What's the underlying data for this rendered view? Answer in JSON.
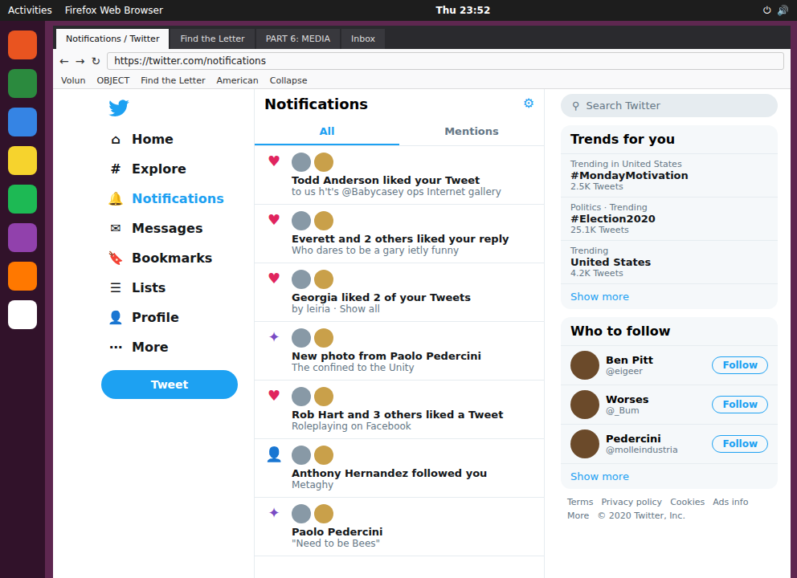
{
  "topbar": {
    "activities": "Activities",
    "app": "Firefox Web Browser",
    "clock": "Thu 23:52",
    "tray": [
      "⏻",
      "🔊"
    ]
  },
  "dock": [
    {
      "color": "#e95420"
    },
    {
      "color": "#2b8a3e"
    },
    {
      "color": "#3584e4"
    },
    {
      "color": "#f6d32d"
    },
    {
      "color": "#1db954"
    },
    {
      "color": "#9141ac"
    },
    {
      "color": "#ff7800"
    },
    {
      "color": "#ffffff"
    }
  ],
  "browser_tabs": [
    {
      "label": "Notifications / Twitter",
      "selected": true
    },
    {
      "label": "Find the Letter",
      "selected": false
    },
    {
      "label": "PART 6: MEDIA",
      "selected": false
    },
    {
      "label": "Inbox",
      "selected": false
    }
  ],
  "url": "https://twitter.com/notifications",
  "bookmarks": [
    "Volun",
    "OBJECT",
    "Find the Letter",
    "American",
    "Collapse"
  ],
  "nav": [
    {
      "icon": "⌂",
      "label": "Home",
      "selected": false
    },
    {
      "icon": "#",
      "label": "Explore",
      "selected": false
    },
    {
      "icon": "🔔",
      "label": "Notifications",
      "selected": true
    },
    {
      "icon": "✉",
      "label": "Messages",
      "selected": false
    },
    {
      "icon": "🔖",
      "label": "Bookmarks",
      "selected": false
    },
    {
      "icon": "☰",
      "label": "Lists",
      "selected": false
    },
    {
      "icon": "👤",
      "label": "Profile",
      "selected": false
    },
    {
      "icon": "⋯",
      "label": "More",
      "selected": false
    }
  ],
  "tweet_button": "Tweet",
  "feed": {
    "title": "Notifications",
    "tabs": [
      {
        "label": "All",
        "selected": true
      },
      {
        "label": "Mentions",
        "selected": false
      }
    ],
    "items": [
      {
        "kind": "like",
        "text": "Todd Anderson liked your Tweet",
        "snippet": "to us h't's @Babycasey ops Internet gallery"
      },
      {
        "kind": "like",
        "text": "Everett and 2 others liked your reply",
        "snippet": "Who dares to be a gary ietly funny"
      },
      {
        "kind": "like",
        "text": "Georgia liked 2 of your Tweets",
        "snippet": "by leiria · Show all"
      },
      {
        "kind": "photo",
        "text": "New photo from Paolo Pedercini",
        "snippet": "The confined to the Unity"
      },
      {
        "kind": "like",
        "text": "Rob Hart and 3 others liked a Tweet",
        "snippet": "Roleplaying on Facebook"
      },
      {
        "kind": "follow",
        "text": "Anthony Hernandez followed you",
        "snippet": "Metaghy"
      },
      {
        "kind": "photo",
        "text": "Paolo Pedercini",
        "snippet": "\"Need to be Bees\""
      }
    ]
  },
  "search": {
    "placeholder": "Search Twitter"
  },
  "trends": {
    "title": "Trends for you",
    "items": [
      {
        "context": "Trending in United States",
        "name": "#MondayMotivation",
        "count": "2.5K Tweets"
      },
      {
        "context": "Politics · Trending",
        "name": "#Election2020",
        "count": "25.1K Tweets"
      },
      {
        "context": "Trending",
        "name": "United States",
        "count": "4.2K Tweets"
      }
    ],
    "more": "Show more"
  },
  "follow": {
    "title": "Who to follow",
    "items": [
      {
        "name": "Ben Pitt",
        "handle": "@eigeer",
        "button": "Follow"
      },
      {
        "name": "Worses",
        "handle": "@_Bum",
        "button": "Follow"
      },
      {
        "name": "Pedercini",
        "handle": "@molleindustria",
        "button": "Follow"
      }
    ],
    "more": "Show more"
  },
  "footer": [
    "Terms",
    "Privacy policy",
    "Cookies",
    "Ads info",
    "More",
    "© 2020 Twitter, Inc."
  ]
}
